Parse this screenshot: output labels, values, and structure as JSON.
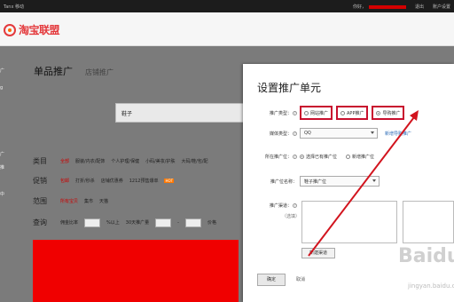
{
  "topbar": {
    "left": "Tanx 移动",
    "user_prefix": "你好，",
    "logout": "退出",
    "account": "账户设置"
  },
  "header": {
    "logo_text": "淘宝联盟"
  },
  "left_strip": [
    "广",
    "g",
    "i",
    "广",
    "推",
    "广",
    "中"
  ],
  "page": {
    "tab_single": "单品推广",
    "tab_shop": "店铺推广",
    "search_value": "鞋子",
    "filters": {
      "category": {
        "label": "类目",
        "items": [
          "全部",
          "服装/内衣/配饰",
          "个人护理/保健",
          "小码/美妆/护肤",
          "大码/鞋/包/配",
          "家居/家装/家纺"
        ]
      },
      "promo": {
        "label": "促销",
        "items": [
          "包邮",
          "打折/秒杀",
          "店铺优惠券",
          "1212预售爆单"
        ],
        "hot": "HOT"
      },
      "scope": {
        "label": "范围",
        "items": [
          "所有宝贝",
          "集市",
          "天猫"
        ]
      },
      "query": {
        "label": "查询",
        "commission_label": "佣金比率",
        "percent": "%以上",
        "sales_label": "30天推广量",
        "dash": "-",
        "ticket_label": "价格"
      }
    }
  },
  "dialog": {
    "title": "设置推广单元",
    "type_label": "推广类型：",
    "type_options": [
      "网站推广",
      "APP推广",
      "导购推广"
    ],
    "media_label": "媒体类型：",
    "media_value": "QQ",
    "add_link": "新增导购推广",
    "spot_label": "所在推广位：",
    "spot_opt1": "选择已有推广位",
    "spot_opt2": "新增推广位",
    "name_label": "推广位名称：",
    "name_value": "鞋子推广位",
    "channel_label": "推广渠道：",
    "channel_hint": "（选填）",
    "new_channel_btn": "新建渠道",
    "confirm": "确定",
    "cancel": "取消"
  },
  "watermark": {
    "brand": "Baidu",
    "site": "jingyan.baidu.com"
  },
  "colors": {
    "highlight": "#c8102e",
    "arrow": "#d2141e",
    "brand": "#e4393c"
  }
}
